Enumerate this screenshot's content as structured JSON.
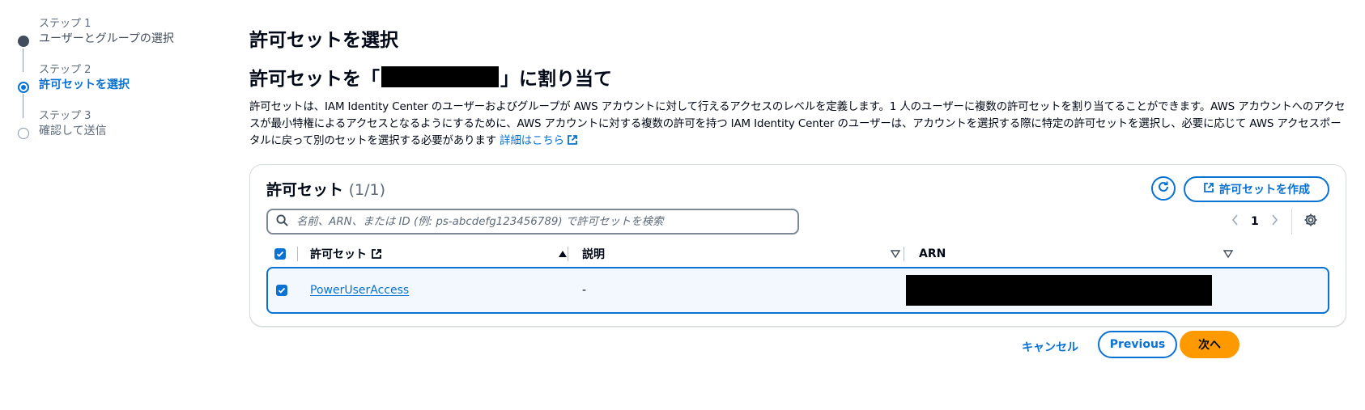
{
  "steps": [
    {
      "num": "ステップ 1",
      "title": "ユーザーとグループの選択",
      "state": "done"
    },
    {
      "num": "ステップ 2",
      "title": "許可セットを選択",
      "state": "active"
    },
    {
      "num": "ステップ 3",
      "title": "確認して送信",
      "state": "future"
    }
  ],
  "page": {
    "title": "許可セットを選択",
    "assign_prefix": "許可セットを「",
    "assign_suffix": "」に割り当て",
    "description": "許可セットは、IAM Identity Center のユーザーおよびグループが AWS アカウントに対して行えるアクセスのレベルを定義します。1 人のユーザーに複数の許可セットを割り当てることができます。AWS アカウントへのアクセスが最小特権によるアクセスとなるようにするために、AWS アカウントに対する複数の許可を持つ IAM Identity Center のユーザーは、アカウントを選択する際に特定の許可セットを選択し、必要に応じて AWS アクセスポータルに戻って別のセットを選択する必要があります ",
    "learn_more": "詳細はこちら"
  },
  "table": {
    "title": "許可セット",
    "count": "(1/1)",
    "create_label": "許可セットを作成",
    "search_placeholder": "名前、ARN、または ID (例: ps-abcdefg123456789) で許可セットを検索",
    "page_number": "1",
    "columns": {
      "name": "許可セット",
      "description": "説明",
      "arn": "ARN"
    },
    "rows": [
      {
        "name": "PowerUserAccess",
        "description": "-",
        "selected": true
      }
    ]
  },
  "footer": {
    "cancel": "キャンセル",
    "previous": "Previous",
    "next": "次へ"
  },
  "colors": {
    "accent": "#0972d3",
    "primary_button": "#ff9900",
    "text": "#000716"
  }
}
